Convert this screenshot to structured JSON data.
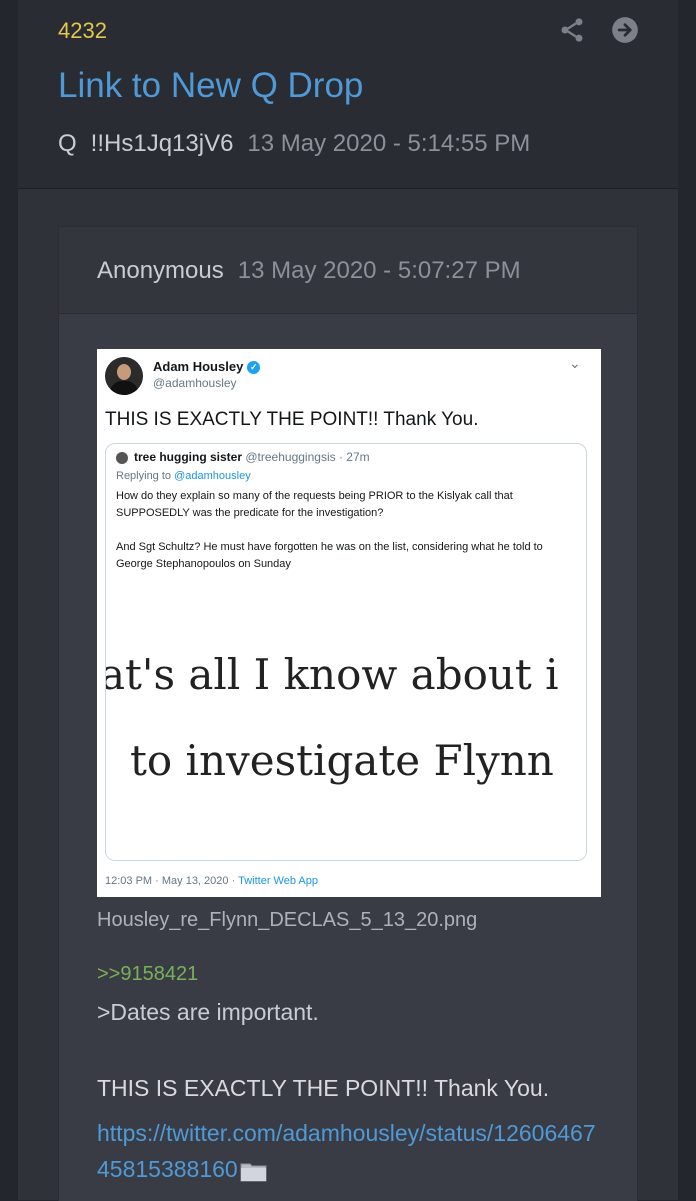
{
  "drop": {
    "number": "4232",
    "title": "Link to New Q Drop",
    "author": "Q",
    "tripcode": "!!Hs1Jq13jV6",
    "timestamp": "13 May 2020 - 5:14:55 PM"
  },
  "quoted_post": {
    "author": "Anonymous",
    "timestamp": "13 May 2020 - 5:07:27 PM",
    "image": {
      "filename": "Housley_re_Flynn_DECLAS_5_13_20.png",
      "tweet": {
        "name": "Adam Housley",
        "handle": "@adamhousley",
        "text": "THIS IS EXACTLY THE POINT!! Thank You.",
        "quote": {
          "name": "tree hugging sister",
          "meta": "@treehuggingsis · 27m",
          "replying_prefix": "Replying to ",
          "replying_to": "@adamhousley",
          "paragraph1": "How do they explain so many of the requests being PRIOR to the Kislyak call that SUPPOSEDLY was the predicate for the investigation?",
          "paragraph2": "And Sgt Schultz? He must have forgotten he was on the list, considering what he told to George Stephanopoulos on Sunday",
          "image_line1": "at's all I know about i",
          "image_line2": "to investigate Flynn"
        },
        "footer_time": "12:03 PM · May 13, 2020 · ",
        "footer_app": "Twitter Web App"
      }
    },
    "reply_link": ">>9158421",
    "greentext": ">Dates are important.",
    "text": "THIS IS EXACTLY THE POINT!! Thank You.",
    "url": "https://twitter.com/adamhousley/status/1260646745815388160"
  },
  "icons": {
    "share": "share-icon",
    "go": "arrow-circle-right-icon",
    "folder": "folder-icon",
    "verified": "verified-badge-icon",
    "chevron": "chevron-down-icon"
  },
  "colors": {
    "background": "#24262d",
    "card": "#30323a",
    "drop_number": "#e2c94a",
    "link": "#4f9ad6",
    "reply_link": "#78b159"
  }
}
